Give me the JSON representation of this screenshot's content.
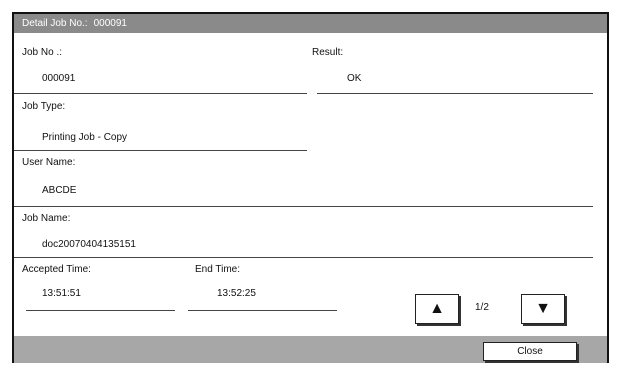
{
  "title": {
    "label": "Detail Job No.:",
    "job_no": "000091"
  },
  "fields": {
    "job_no": {
      "label": "Job No .:",
      "value": "000091"
    },
    "result": {
      "label": "Result:",
      "value": "OK"
    },
    "job_type": {
      "label": "Job Type:",
      "value": "Printing Job - Copy"
    },
    "user_name": {
      "label": "User Name:",
      "value": "ABCDE"
    },
    "job_name": {
      "label": "Job Name:",
      "value": "doc20070404135151"
    },
    "accepted_time": {
      "label": "Accepted Time:",
      "value": "13:51:51"
    },
    "end_time": {
      "label": "End Time:",
      "value": "13:52:25"
    }
  },
  "pager": {
    "indicator": "1/2",
    "up_icon": "triangle-up",
    "down_icon": "triangle-down"
  },
  "footer": {
    "close_label": "Close"
  },
  "colors": {
    "titlebar_bg": "#8a8a8a",
    "footer_bg": "#a7a7a7"
  }
}
